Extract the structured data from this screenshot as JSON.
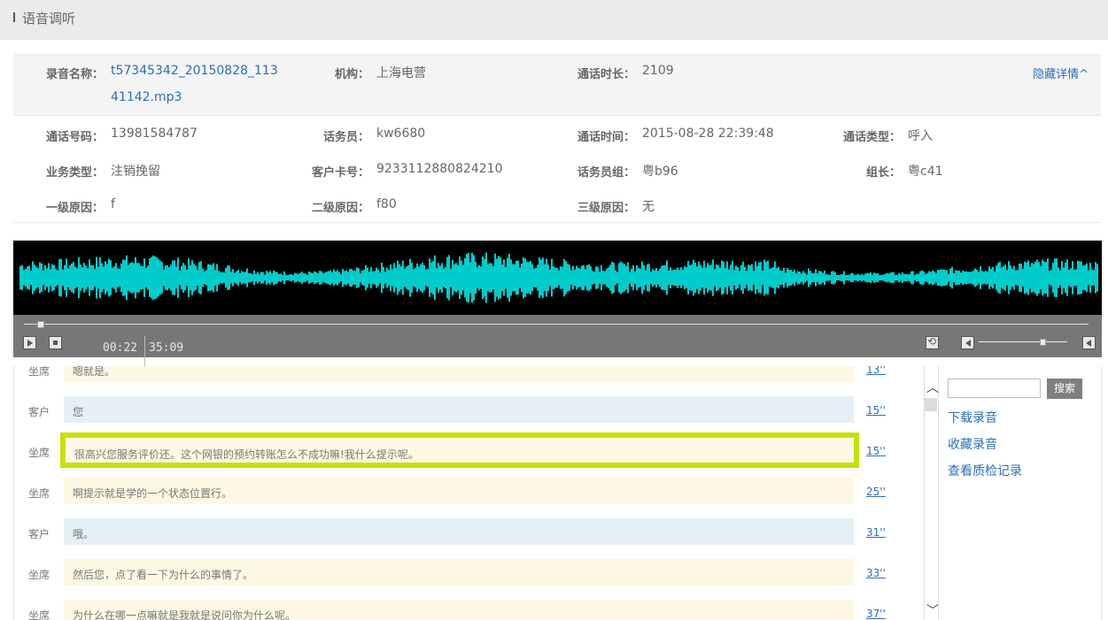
{
  "page": {
    "title": "语音调听"
  },
  "info": {
    "hide_details": "隐藏详情^",
    "recording_name_label": "录音名称：",
    "recording_name_line1": "t57345342_20150828_113",
    "recording_name_line2": "41142.mp3",
    "org_label": "机构：",
    "org_value": "上海电营",
    "duration_label": "通话时长：",
    "duration_value": "2109",
    "phone_label": "通话号码：",
    "phone_value": "13981584787",
    "operator_label": "话务员：",
    "operator_value": "kw6680",
    "call_time_label": "通话时间：",
    "call_time_value": "2015-08-28 22:39:48",
    "call_type_label": "通话类型：",
    "call_type_value": "呼入",
    "biz_type_label": "业务类型：",
    "biz_type_value": "注销挽留",
    "card_label": "客户卡号：",
    "card_value": "9233112880824210",
    "group_label": "话务员组：",
    "group_value": "粤b96",
    "leader_label": "组长：",
    "leader_value": "粤c41",
    "reason1_label": "一级原因：",
    "reason1_value": "f",
    "reason2_label": "二级原因：",
    "reason2_value": "f80",
    "reason3_label": "三级原因：",
    "reason3_value": "无"
  },
  "player": {
    "current_time": "00:22",
    "total_time": "35:09",
    "progress_fraction": 0.015,
    "volume_fraction": 0.72,
    "waveform_color": "#00ffff"
  },
  "transcript": [
    {
      "speaker": "坐席",
      "text": "嗯就是。",
      "time": "13''",
      "kind": "agent"
    },
    {
      "speaker": "客户",
      "text": "您",
      "time": "15''",
      "kind": "cust"
    },
    {
      "speaker": "坐席",
      "text": "很高兴您服务评价还。这个网银的预约转账怎么不成功嘛!我什么提示呢。",
      "time": "15''",
      "kind": "agent",
      "highlight": true
    },
    {
      "speaker": "坐席",
      "text": "啊提示就是学的一个状态位置行。",
      "time": "25''",
      "kind": "agent"
    },
    {
      "speaker": "客户",
      "text": "哦。",
      "time": "31''",
      "kind": "cust"
    },
    {
      "speaker": "坐席",
      "text": "然后您，点了看一下为什么的事情了。",
      "time": "33''",
      "kind": "agent"
    },
    {
      "speaker": "坐席",
      "text": "为什么在哪一点嘛就是我就是说问你为什么呢。",
      "time": "37''",
      "kind": "agent"
    }
  ],
  "side": {
    "search_label": "搜索",
    "search_value": "",
    "download": "下载录音",
    "favorite": "收藏录音",
    "qc_record": "查看质检记录"
  }
}
